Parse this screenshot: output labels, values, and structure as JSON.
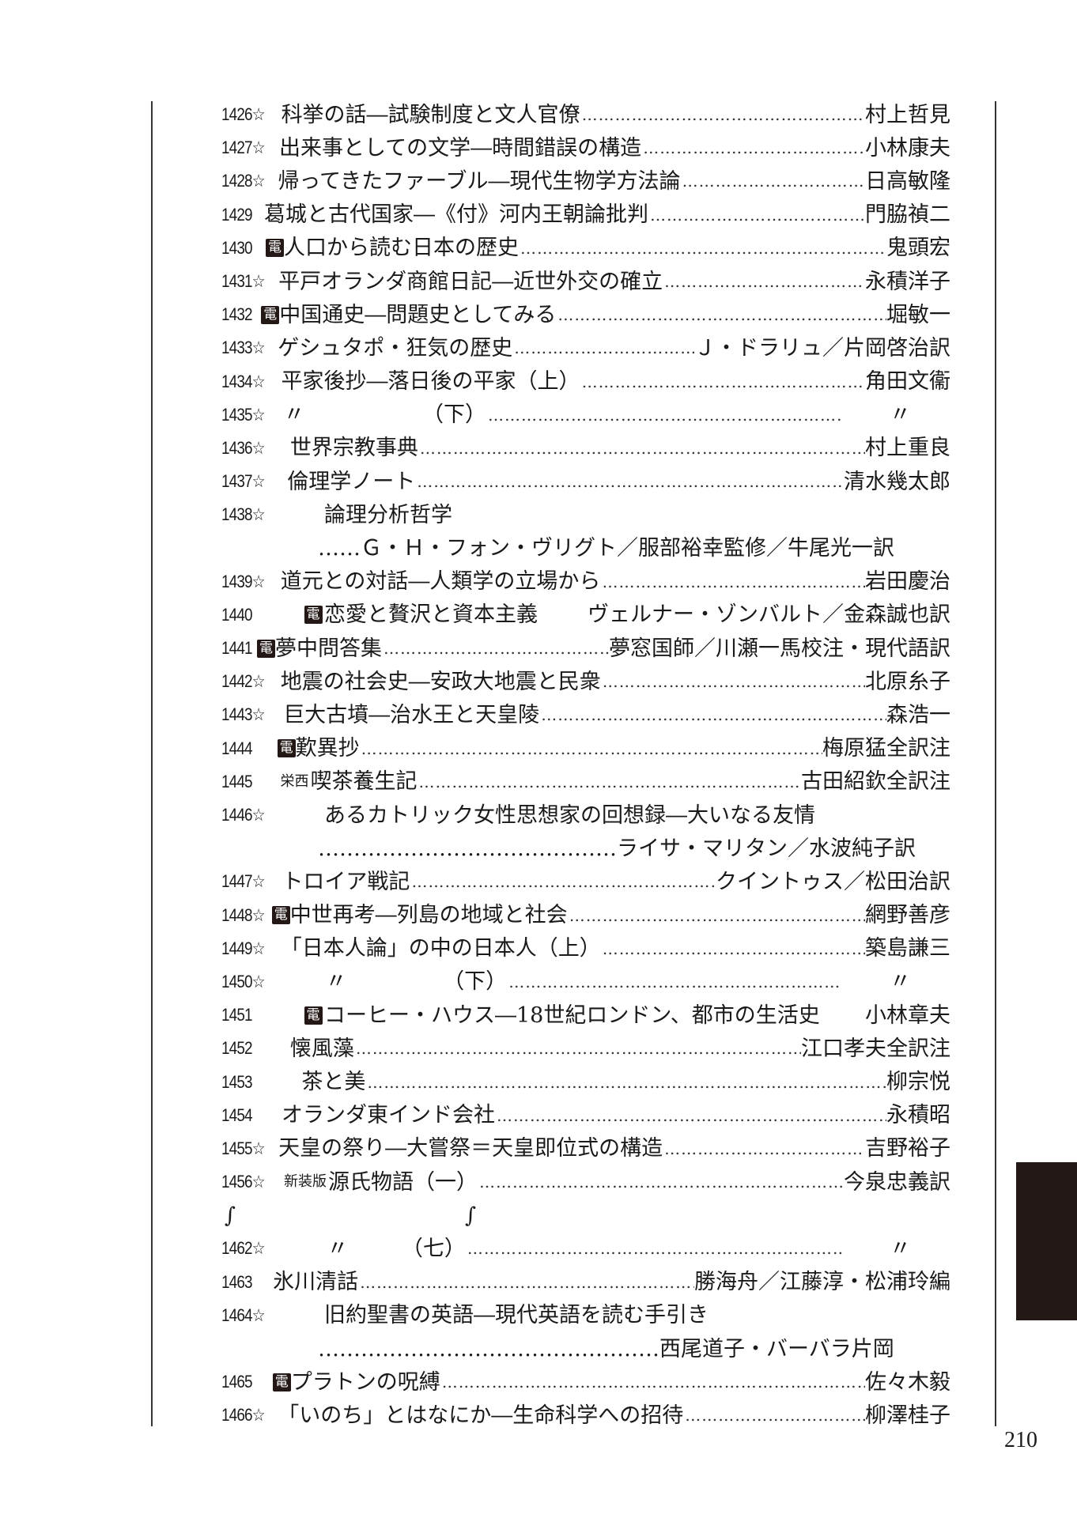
{
  "page_number": "210",
  "entries": [
    {
      "no": "1426",
      "star": "☆",
      "title": "科挙の話―試験制度と文人官僚",
      "author": "村上哲見"
    },
    {
      "no": "1427",
      "star": "☆",
      "title": "出来事としての文学―時間錯誤の構造",
      "author": "小林康夫"
    },
    {
      "no": "1428",
      "star": "☆",
      "title": "帰ってきたファーブル―現代生物学方法論",
      "author": "日高敏隆"
    },
    {
      "no": "1429",
      "star": "",
      "title": "葛城と古代国家―《付》河内王朝論批判",
      "author": "門脇禎二"
    },
    {
      "no": "1430",
      "star": "",
      "den": "電",
      "title": "人口から読む日本の歴史",
      "author": "鬼頭宏"
    },
    {
      "no": "1431",
      "star": "☆",
      "title": "平戸オランダ商館日記―近世外交の確立",
      "author": "永積洋子"
    },
    {
      "no": "1432",
      "star": "",
      "den": "電",
      "title": "中国通史―問題史としてみる",
      "author": "堀敏一"
    },
    {
      "no": "1433",
      "star": "☆",
      "title": "ゲシュタポ・狂気の歴史",
      "author": "Ｊ・ドラリュ／片岡啓治訳"
    },
    {
      "no": "1434",
      "star": "☆",
      "title": "平家後抄―落日後の平家（上）",
      "author": "角田文衞"
    },
    {
      "no": "1435",
      "star": "☆",
      "title": "〃　　　　　　（下）",
      "author": "〃",
      "dotsEnd": true
    },
    {
      "no": "1436",
      "star": "☆",
      "title": "世界宗教事典",
      "author": "村上重良"
    },
    {
      "no": "1437",
      "star": "☆",
      "title": "倫理学ノート",
      "author": "清水幾太郎"
    },
    {
      "no": "1438",
      "star": "☆",
      "title": "論理分析哲学",
      "author": "",
      "nodots": true
    },
    {
      "cont": "……Ｇ・Ｈ・フォン・ヴリグト／服部裕幸監修／牛尾光一訳"
    },
    {
      "no": "1439",
      "star": "☆",
      "title": "道元との対話―人類学の立場から",
      "author": "岩田慶治"
    },
    {
      "no": "1440",
      "star": "",
      "den": "電",
      "title": "恋愛と贅沢と資本主義",
      "author": "ヴェルナー・ゾンバルト／金森誠也訳",
      "nodots": true,
      "gap": true
    },
    {
      "no": "1441",
      "star": "",
      "den": "電",
      "title": "夢中問答集",
      "author": "夢窓国師／川瀬一馬校注・現代語訳"
    },
    {
      "no": "1442",
      "star": "☆",
      "title": "地震の社会史―安政大地震と民衆",
      "author": "北原糸子"
    },
    {
      "no": "1443",
      "star": "☆",
      "title": "巨大古墳―治水王と天皇陵",
      "author": "森浩一"
    },
    {
      "no": "1444",
      "star": "",
      "den": "電",
      "title": "歎異抄",
      "author": "梅原猛全訳注"
    },
    {
      "no": "1445",
      "star": "",
      "prefix": "栄西",
      "title": "喫茶養生記",
      "author": "古田紹欽全訳注"
    },
    {
      "no": "1446",
      "star": "☆",
      "title": "あるカトリック女性思想家の回想録―大いなる友情",
      "author": "",
      "nodots": true
    },
    {
      "cont": "……………………………………ライサ・マリタン／水波純子訳"
    },
    {
      "no": "1447",
      "star": "☆",
      "title": "トロイア戦記",
      "author": "クイントゥス／松田治訳"
    },
    {
      "no": "1448",
      "star": "☆",
      "den": "電",
      "title": "中世再考―列島の地域と社会",
      "author": "網野善彦"
    },
    {
      "no": "1449",
      "star": "☆",
      "title": "「日本人論」の中の日本人（上）",
      "author": "築島謙三"
    },
    {
      "no": "1450",
      "star": "☆",
      "title": "　　〃　　　　　（下）",
      "author": "〃",
      "dotsEnd": true
    },
    {
      "no": "1451",
      "star": "",
      "den": "電",
      "title": "コーヒー・ハウス―18世紀ロンドン、都市の生活史",
      "author": "小林章夫",
      "nodots": true,
      "gap": true
    },
    {
      "no": "1452",
      "star": "",
      "title": "懐風藻",
      "author": "江口孝夫全訳注"
    },
    {
      "no": "1453",
      "star": "",
      "title": "茶と美",
      "author": "柳宗悦"
    },
    {
      "no": "1454",
      "star": "",
      "title": "オランダ東インド会社",
      "author": "永積昭"
    },
    {
      "no": "1455",
      "star": "☆",
      "title": "天皇の祭り―大嘗祭＝天皇即位式の構造",
      "author": "吉野裕子"
    },
    {
      "no": "1456",
      "star": "☆",
      "prefix": "新装版",
      "title": "源氏物語（一）",
      "author": "今泉忠義訳"
    },
    {
      "rep": "∫",
      "rep2": "∫"
    },
    {
      "no": "1462",
      "star": "☆",
      "title": "　　〃　　　（七）",
      "author": "〃",
      "dotsEnd": true
    },
    {
      "no": "1463",
      "star": "",
      "title": "氷川清話",
      "author": "勝海舟／江藤淳・松浦玲編"
    },
    {
      "no": "1464",
      "star": "☆",
      "title": "旧約聖書の英語―現代英語を読む手引き",
      "author": "",
      "nodots": true
    },
    {
      "cont": "…………………………………………西尾道子・バーバラ片岡"
    },
    {
      "no": "1465",
      "star": "",
      "den": "電",
      "title": "プラトンの呪縛",
      "author": "佐々木毅"
    },
    {
      "no": "1466",
      "star": "☆",
      "title": "「いのち」とはなにか―生命科学への招待",
      "author": "柳澤桂子"
    }
  ]
}
